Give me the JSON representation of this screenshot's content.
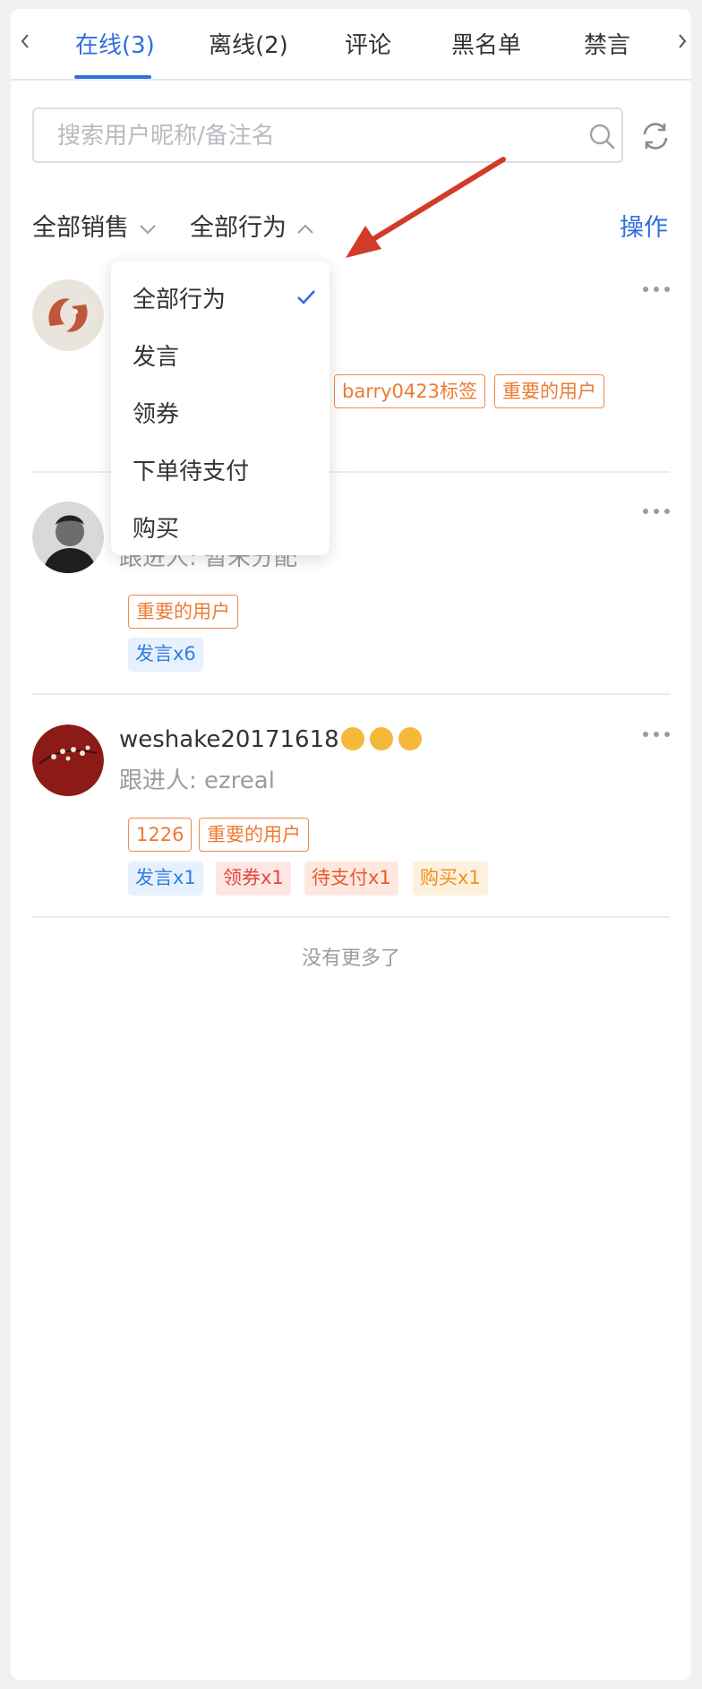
{
  "tabs": {
    "items": [
      {
        "label": "在线(3)",
        "active": true
      },
      {
        "label": "离线(2)",
        "active": false
      },
      {
        "label": "评论",
        "active": false
      },
      {
        "label": "黑名单",
        "active": false
      },
      {
        "label": "禁言",
        "active": false
      }
    ],
    "left_arrow_icon": "chevron-left-icon",
    "right_arrow_icon": "chevron-right-icon"
  },
  "search": {
    "placeholder": "搜索用户昵称/备注名",
    "value": "",
    "icon": "search-icon",
    "refresh_icon": "refresh-icon"
  },
  "filters": {
    "sales": {
      "label": "全部销售",
      "icon": "chevron-down-icon"
    },
    "behavior": {
      "label": "全部行为",
      "icon": "chevron-up-icon",
      "open": true
    },
    "action_label": "操作"
  },
  "dropdown": {
    "items": [
      {
        "label": "全部行为",
        "selected": true
      },
      {
        "label": "发言",
        "selected": false
      },
      {
        "label": "领券",
        "selected": false
      },
      {
        "label": "下单待支付",
        "selected": false
      },
      {
        "label": "购买",
        "selected": false
      }
    ],
    "check_icon": "check-icon"
  },
  "users": [
    {
      "name": "",
      "follower": "",
      "tags": [
        {
          "label": "barry0423标签",
          "style": "orange"
        },
        {
          "label": "重要的用户",
          "style": "orange"
        }
      ],
      "actions": []
    },
    {
      "name": "",
      "follower": "跟进人: 暂未分配",
      "tags": [
        {
          "label": "重要的用户",
          "style": "orange"
        }
      ],
      "actions": [
        {
          "label": "发言x6",
          "style": "blue"
        }
      ]
    },
    {
      "name": "weshake20171618",
      "emoji_count": 3,
      "follower": "跟进人: ezreal",
      "tags": [
        {
          "label": "1226",
          "style": "orange"
        },
        {
          "label": "重要的用户",
          "style": "orange"
        }
      ],
      "actions": [
        {
          "label": "发言x1",
          "style": "blue"
        },
        {
          "label": "领券x1",
          "style": "red"
        },
        {
          "label": "待支付x1",
          "style": "peach"
        },
        {
          "label": "购买x1",
          "style": "yellow"
        }
      ]
    }
  ],
  "footer": {
    "no_more": "没有更多了"
  },
  "colors": {
    "accent": "#2f6fde",
    "tag_orange": "#ee7a33",
    "annotation_arrow": "#d23a2a"
  }
}
